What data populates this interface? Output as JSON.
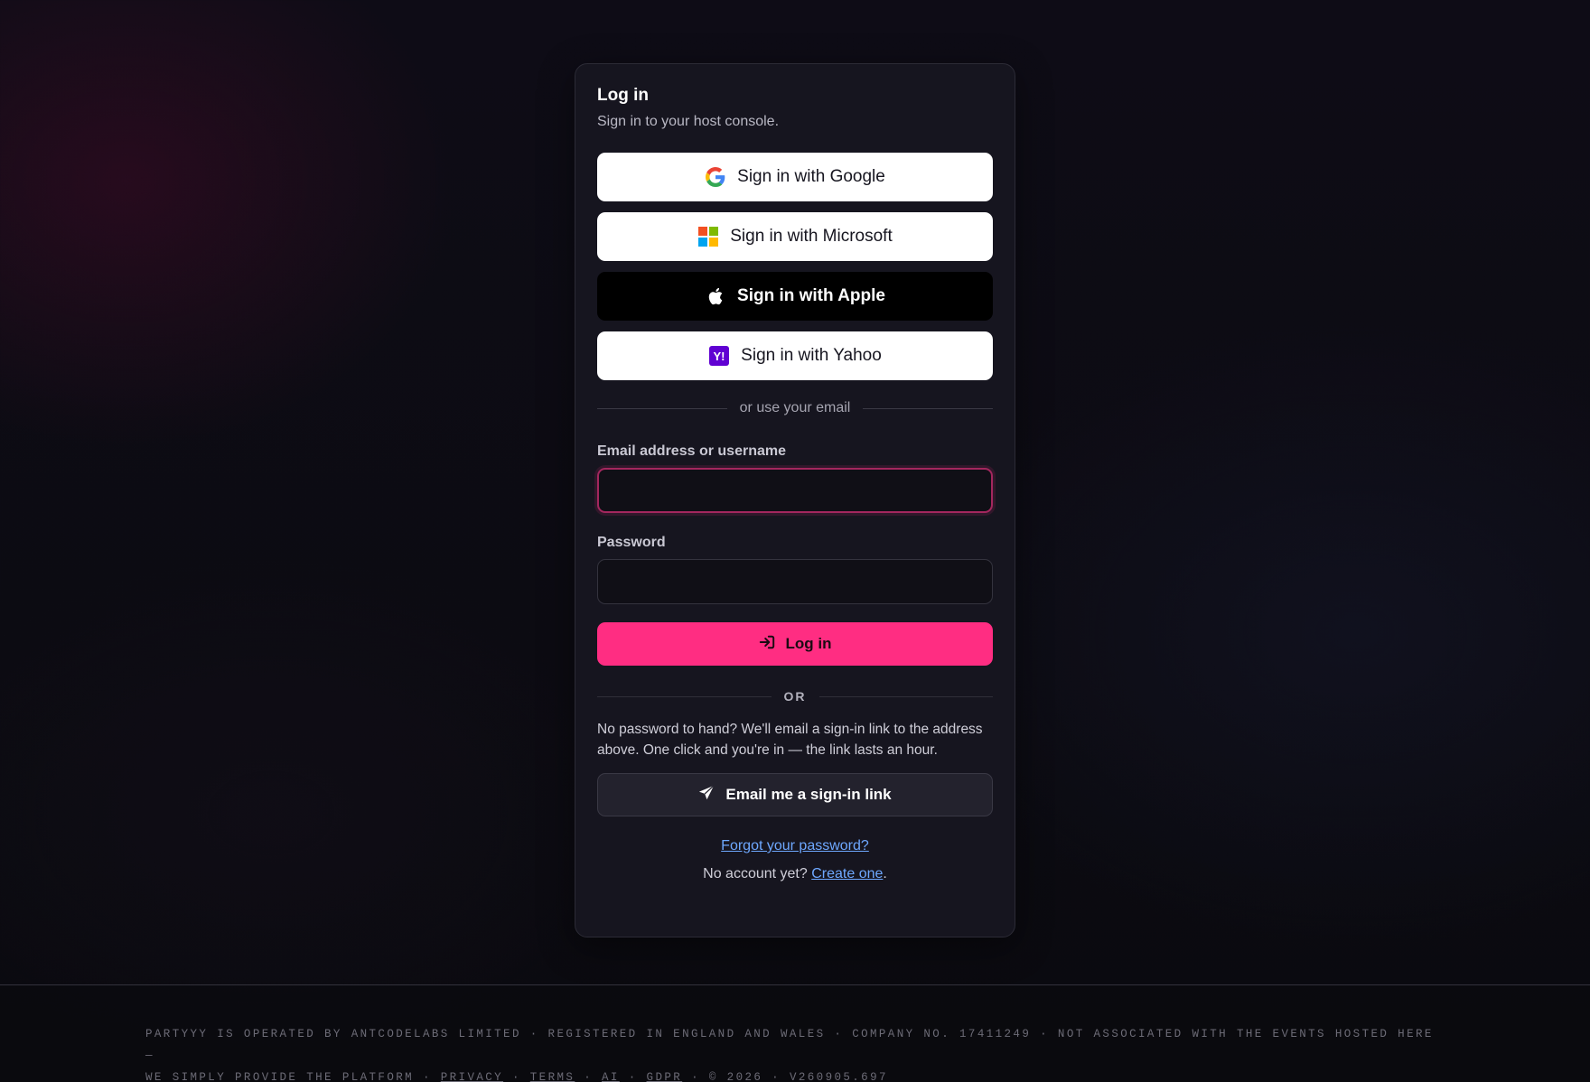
{
  "login": {
    "title": "Log in",
    "subtitle": "Sign in to your host console."
  },
  "sso": {
    "google": {
      "label": "Sign in with Google",
      "icon": "google-icon"
    },
    "microsoft": {
      "label": "Sign in with Microsoft",
      "icon": "microsoft-icon"
    },
    "apple": {
      "label": "Sign in with Apple",
      "icon": "apple-icon"
    },
    "yahoo": {
      "label": "Sign in with Yahoo",
      "icon": "yahoo-icon"
    }
  },
  "email_divider": "or use your email",
  "form": {
    "email_label": "Email address or username",
    "email_value": "",
    "password_label": "Password",
    "password_value": "",
    "submit_label": "Log in"
  },
  "or_divider": "OR",
  "magic_link": {
    "description": "No password to hand? We'll email a sign-in link to the address above. One click and you're in — the link lasts an hour.",
    "button_label": "Email me a sign-in link"
  },
  "links": {
    "forgot": "Forgot your password?",
    "no_account": "No account yet?",
    "create": "Create one",
    "period": "."
  },
  "footer": {
    "line1": "Partyyy is operated by AntCodeLabs Limited · Registered in England and Wales · Company No. 17411249 · Not associated with the events hosted here —",
    "line2_prefix": "We simply provide the platform ·",
    "privacy": "Privacy",
    "terms": "Terms",
    "ai": "AI",
    "gdpr": "GDPR",
    "sep": "·",
    "copyright": "· © 2026 · v260905.697"
  },
  "colors": {
    "accent": "#ff2d82",
    "card_bg": "#16151f",
    "link": "#6ea8ff"
  }
}
